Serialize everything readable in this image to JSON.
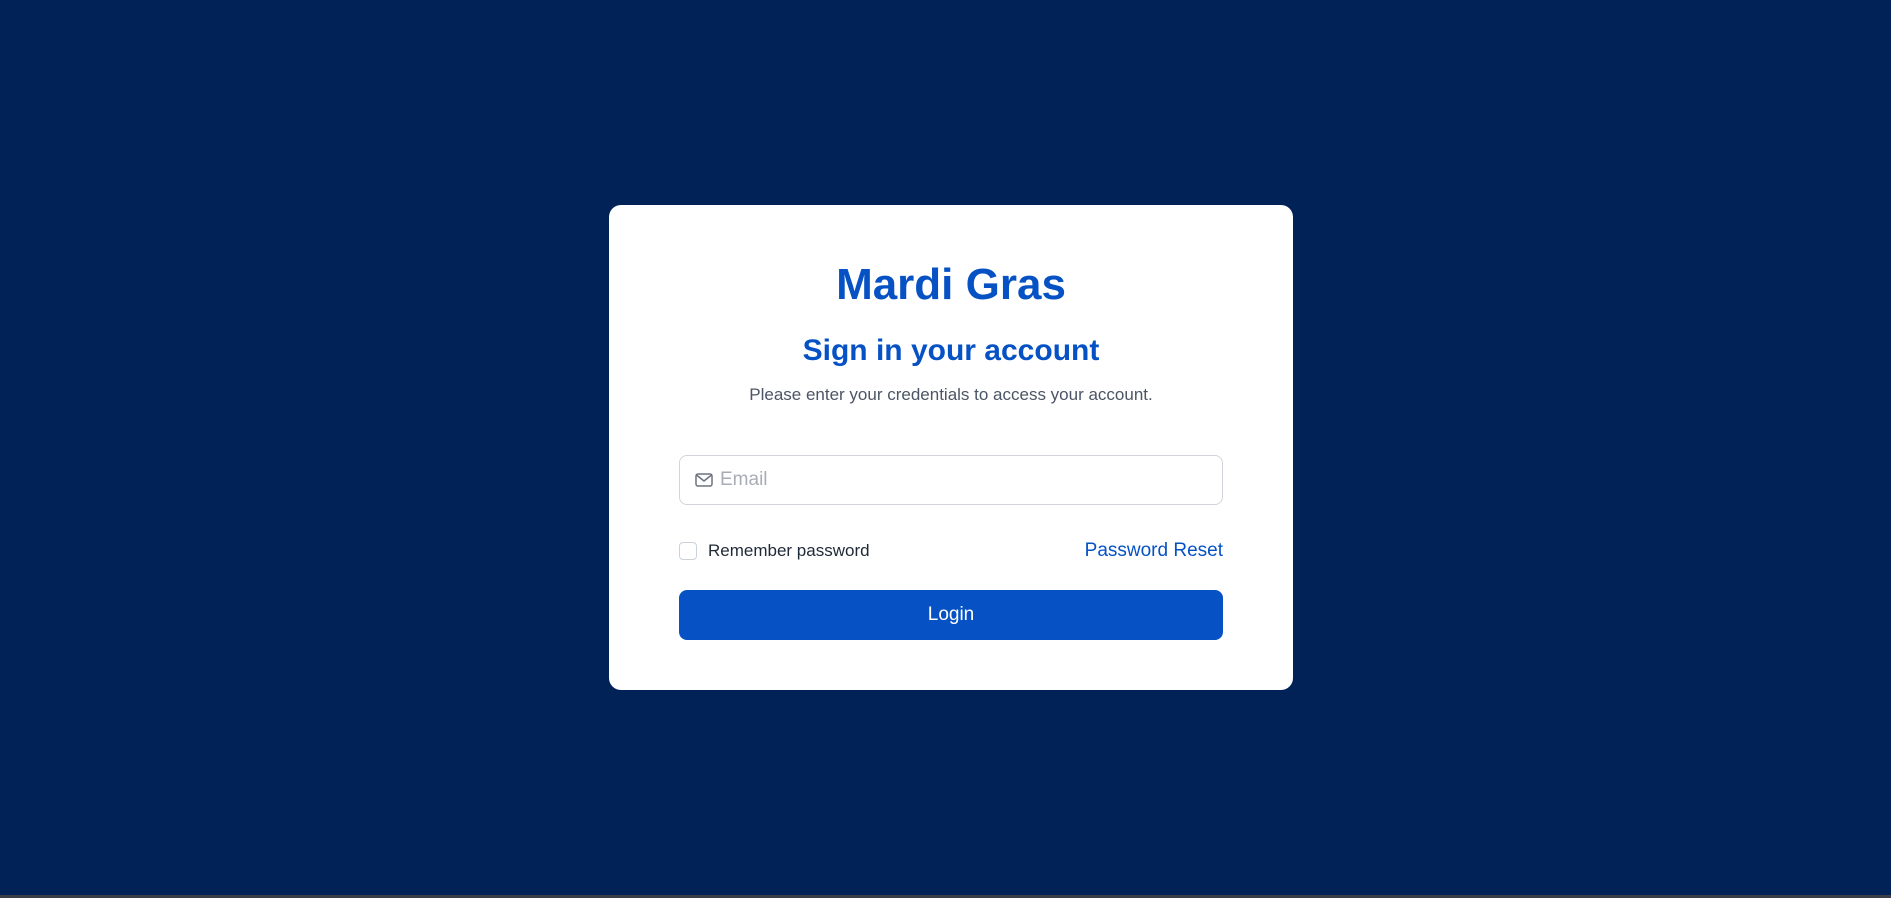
{
  "app": {
    "brand": "Mardi Gras"
  },
  "login_form": {
    "heading": "Sign in your account",
    "subtitle": "Please enter your credentials to access your account.",
    "email": {
      "placeholder": "Email",
      "value": "",
      "icon": "mail-icon"
    },
    "remember": {
      "label": "Remember password",
      "checked": false
    },
    "reset_link_label": "Password Reset",
    "submit_label": "Login"
  },
  "colors": {
    "background": "#002257",
    "accent": "#0652c5",
    "card": "#ffffff"
  }
}
